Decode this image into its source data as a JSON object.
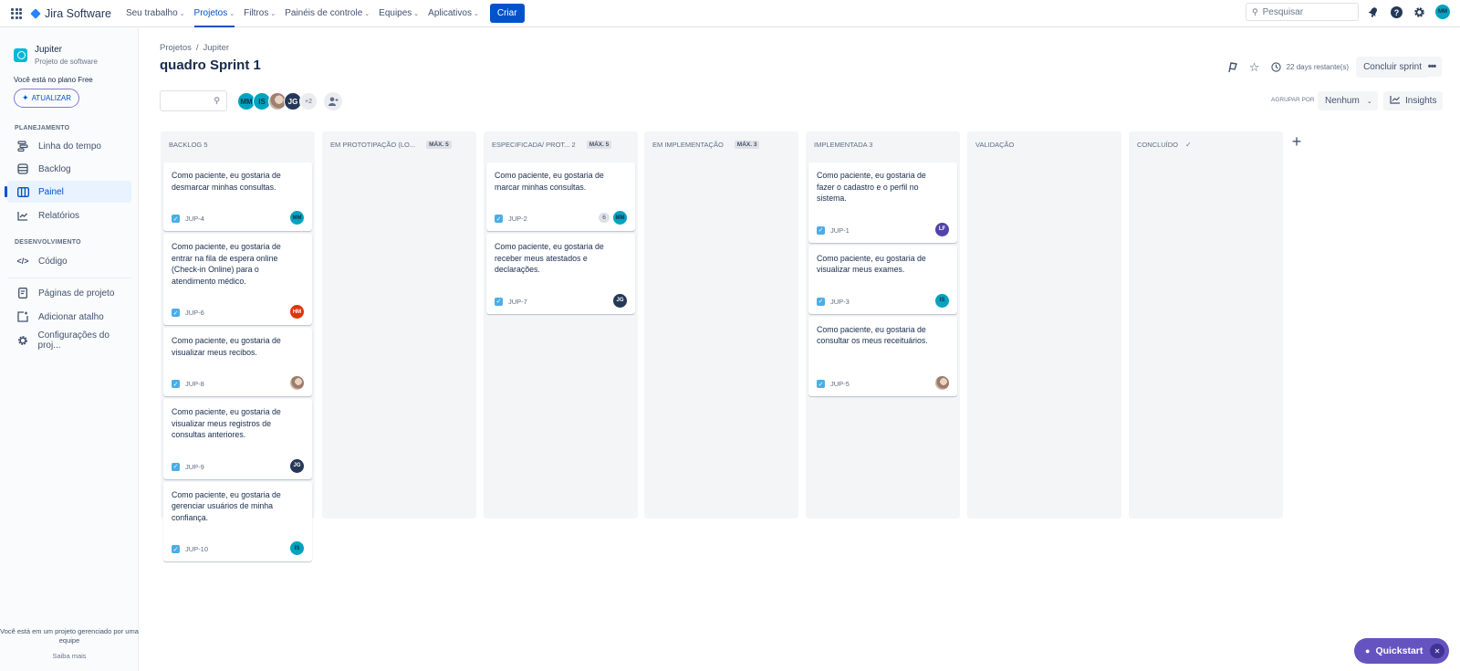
{
  "topnav": {
    "app_name": "Jira Software",
    "items": [
      {
        "label": "Seu trabalho",
        "active": false
      },
      {
        "label": "Projetos",
        "active": true
      },
      {
        "label": "Filtros",
        "active": false
      },
      {
        "label": "Painéis de controle",
        "active": false
      },
      {
        "label": "Equipes",
        "active": false
      },
      {
        "label": "Aplicativos",
        "active": false
      }
    ],
    "create_label": "Criar",
    "search_placeholder": "Pesquisar",
    "user_initials": "MM"
  },
  "sidebar": {
    "project_name": "Jupiter",
    "project_type": "Projeto de software",
    "plan_text": "Você está no plano Free",
    "upgrade_label": "ATUALIZAR",
    "section_planning": "PLANEJAMENTO",
    "section_dev": "DESENVOLVIMENTO",
    "items": [
      {
        "label": "Linha do tempo",
        "icon": "timeline-icon"
      },
      {
        "label": "Backlog",
        "icon": "backlog-icon"
      },
      {
        "label": "Painel",
        "icon": "board-icon",
        "active": true
      },
      {
        "label": "Relatórios",
        "icon": "reports-icon"
      },
      {
        "label": "Código",
        "icon": "code-icon"
      },
      {
        "label": "Páginas de projeto",
        "icon": "pages-icon"
      },
      {
        "label": "Adicionar atalho",
        "icon": "add-shortcut-icon"
      },
      {
        "label": "Configurações do proj...",
        "icon": "settings-icon"
      }
    ],
    "managed_text": "Você está em um projeto gerenciado por uma equipe",
    "learn_more": "Saiba mais"
  },
  "header": {
    "breadcrumb": [
      "Projetos",
      "Jupiter"
    ],
    "breadcrumb_sep": "/",
    "title": "quadro Sprint 1",
    "days_remaining": "22 days restante(s)",
    "complete_sprint": "Concluir sprint",
    "more": "•••",
    "group_by_label": "AGRUPAR POR",
    "group_by_value": "Nenhum",
    "insights_label": "Insights"
  },
  "filter_avatars": [
    {
      "initials": "MM",
      "color": "#00a3bf"
    },
    {
      "initials": "IS",
      "color": "#00a3bf"
    },
    {
      "initials": "",
      "photo": true
    },
    {
      "initials": "JG",
      "color": "#253858"
    }
  ],
  "extra_avatars": "+2",
  "columns": [
    {
      "title": "BACKLOG 5",
      "max": "",
      "done": false,
      "cards": [
        {
          "text": "Como paciente, eu gostaria de desmarcar minhas consultas.",
          "key": "JUP-4",
          "assignee": "MM",
          "color": "#00a3bf"
        },
        {
          "text": "Como paciente, eu gostaria de entrar na fila de espera online (Check-in Online) para o atendimento médico.",
          "key": "JUP-6",
          "assignee": "HM",
          "color": "#de350b"
        },
        {
          "text": "Como paciente, eu gostaria de visualizar meus recibos.",
          "key": "JUP-8",
          "assignee": "",
          "photo": true
        },
        {
          "text": "Como paciente, eu gostaria de visualizar meus registros de consultas anteriores.",
          "key": "JUP-9",
          "assignee": "JG",
          "color": "#253858"
        },
        {
          "text": "Como paciente, eu gostaria de gerenciar usuários de minha confiança.",
          "key": "JUP-10",
          "assignee": "IS",
          "color": "#00a3bf"
        }
      ]
    },
    {
      "title": "EM PROTOTIPAÇÃO (LO...",
      "max": "MÁX. 5",
      "done": false,
      "cards": []
    },
    {
      "title": "ESPECIFICADA/ PROT...  2",
      "max": "MÁX. 5",
      "done": false,
      "cards": [
        {
          "text": "Como paciente, eu gostaria de marcar minhas consultas.",
          "key": "JUP-2",
          "points": "6",
          "assignee": "MM",
          "color": "#00a3bf"
        },
        {
          "text": "Como paciente, eu gostaria de receber meus atestados e declarações.",
          "key": "JUP-7",
          "assignee": "JG",
          "color": "#253858"
        }
      ]
    },
    {
      "title": "EM IMPLEMENTAÇÃO",
      "max": "MÁX. 3",
      "done": false,
      "cards": []
    },
    {
      "title": "IMPLEMENTADA 3",
      "max": "",
      "done": false,
      "cards": [
        {
          "text": "Como paciente, eu gostaria de fazer o cadastro e o perfil no sistema.",
          "key": "JUP-1",
          "assignee": "LF",
          "color": "#5243aa"
        },
        {
          "text": "Como paciente, eu gostaria de visualizar meus exames.",
          "key": "JUP-3",
          "assignee": "IS",
          "color": "#00a3bf"
        },
        {
          "text": "Como paciente, eu gostaria de consultar os meus receituários.",
          "key": "JUP-5",
          "assignee": "",
          "photo": true
        }
      ]
    },
    {
      "title": "VALIDAÇÃO",
      "max": "",
      "done": false,
      "cards": []
    },
    {
      "title": "CONCLUÍDO",
      "max": "",
      "done": true,
      "done_mark": "✓",
      "cards": []
    }
  ],
  "quickstart_label": "Quickstart"
}
